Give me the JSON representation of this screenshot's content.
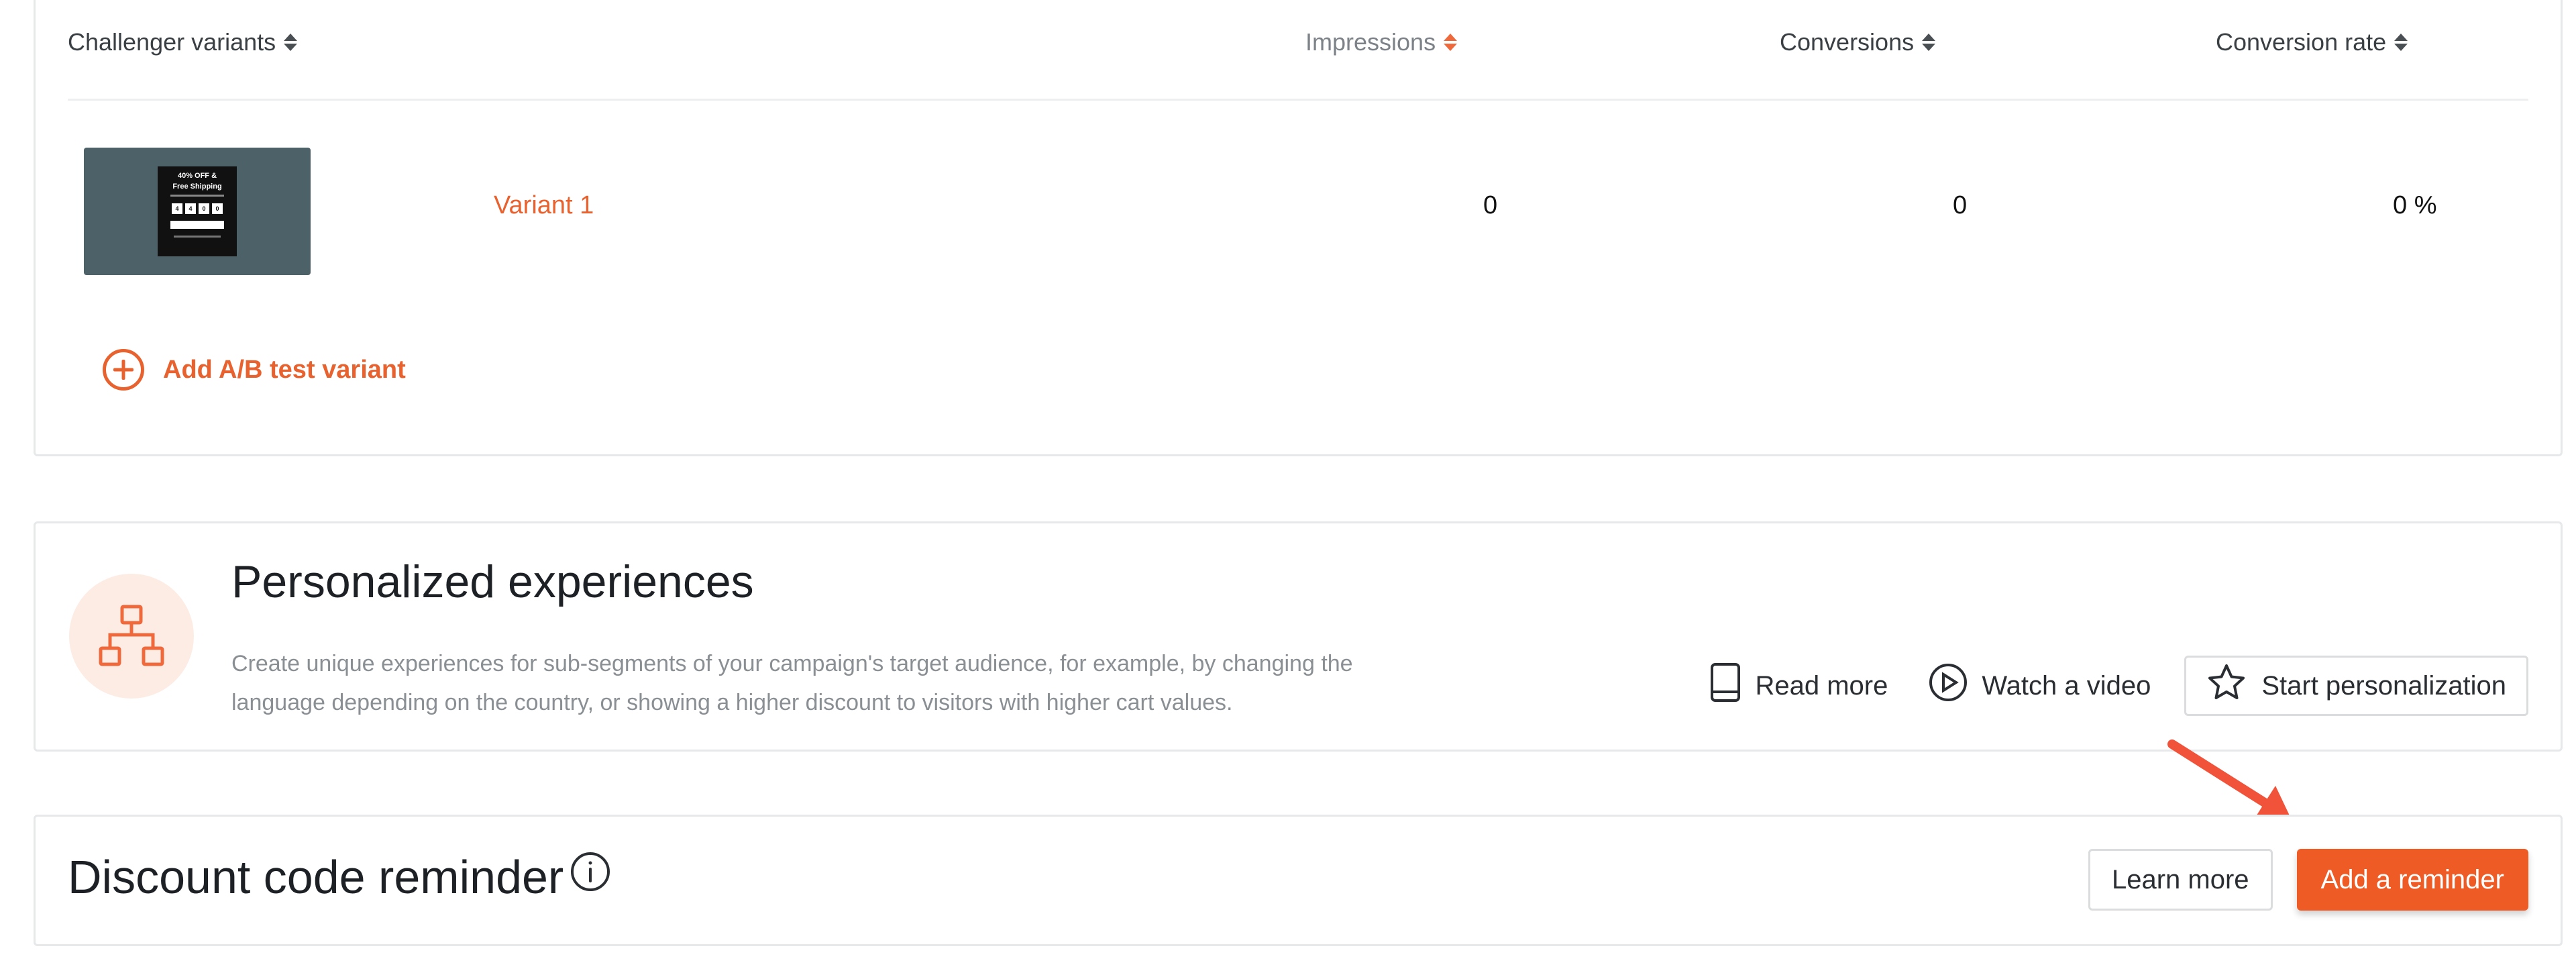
{
  "colors": {
    "accent": "#ee5b25",
    "link": "#e8622f",
    "border": "#e6e8ea",
    "muted_text": "#8a8f94",
    "thumb_bg": "#4d6168",
    "arrow": "#f0533a"
  },
  "variants_table": {
    "headers": {
      "name": "Challenger variants",
      "impressions": "Impressions",
      "conversions": "Conversions",
      "conversion_rate": "Conversion rate"
    },
    "rows": [
      {
        "name": "Variant 1",
        "impressions": "0",
        "conversions": "0",
        "conversion_rate": "0 %",
        "thumbnail": {
          "title_line1": "40% OFF &",
          "title_line2": "Free Shipping",
          "boxes": [
            "4",
            "4",
            "0",
            "0"
          ]
        }
      }
    ],
    "add_variant_label": "Add A/B test variant"
  },
  "personalized": {
    "icon": "sitemap-icon",
    "title": "Personalized experiences",
    "description": "Create unique experiences for sub-segments of your campaign's target audience, for example, by changing the language depending on the country, or showing a higher discount to visitors with higher cart values.",
    "read_more_label": "Read more",
    "read_more_icon": "book-icon",
    "watch_video_label": "Watch a video",
    "watch_video_icon": "play-circle-icon",
    "start_label": "Start personalization",
    "start_icon": "star-icon"
  },
  "discount_reminder": {
    "title": "Discount code reminder",
    "info_icon": "info-icon",
    "learn_more_label": "Learn more",
    "add_label": "Add a reminder"
  }
}
